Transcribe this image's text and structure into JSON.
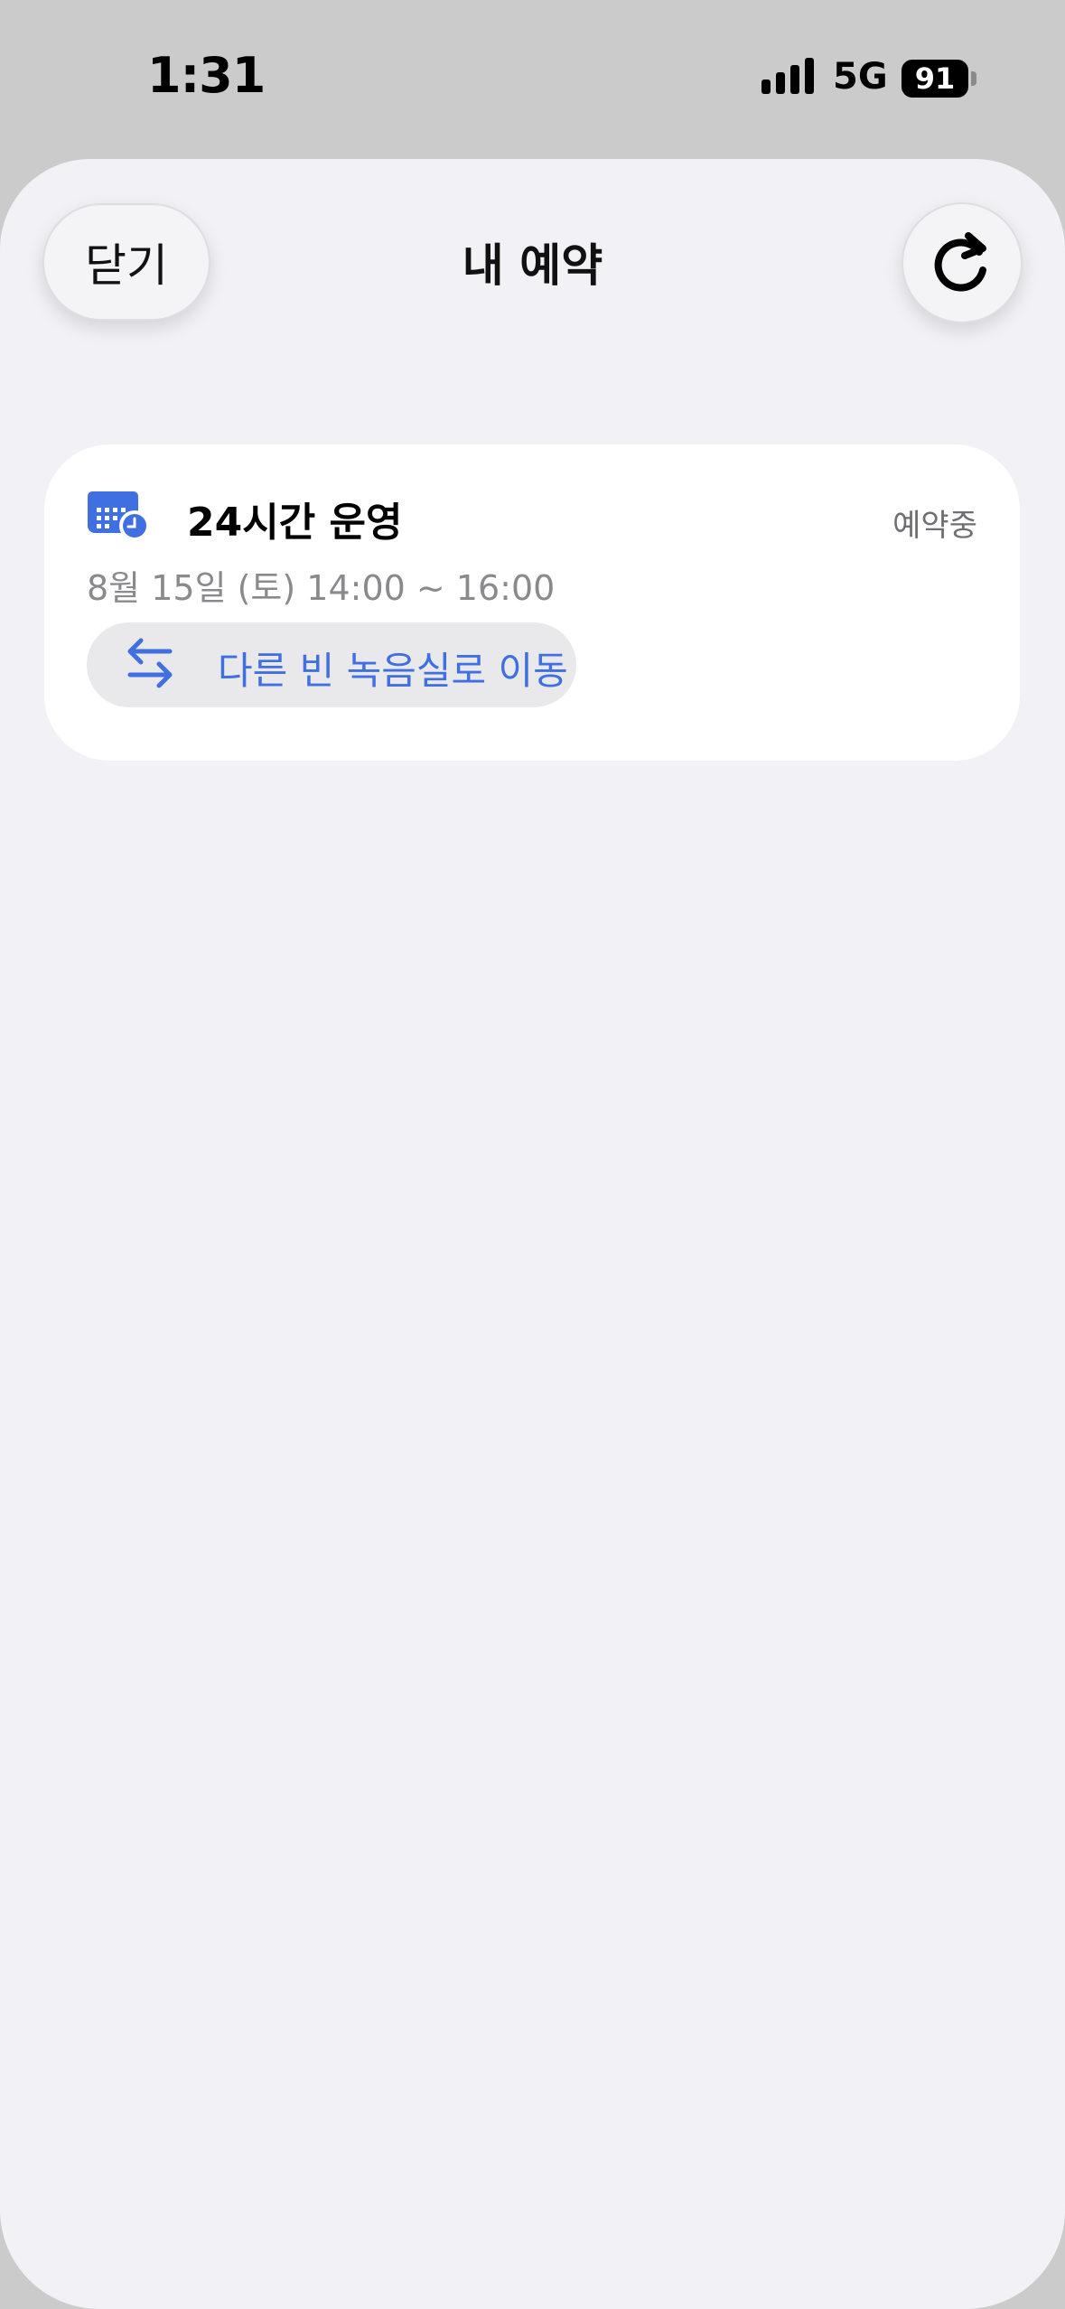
{
  "status_bar": {
    "time": "1:31",
    "network": "5G",
    "battery": "91"
  },
  "header": {
    "close_label": "닫기",
    "title": "내 예약",
    "refresh_icon": "refresh-icon"
  },
  "bookings": [
    {
      "title": "24시간 운영",
      "status": "예약중",
      "datetime": "8월 15일 (토) 14:00 ~ 16:00",
      "action_label": "다른 빈 녹음실로 이동",
      "icon": "calendar-clock-icon",
      "action_icon": "swap-arrows-icon"
    }
  ],
  "colors": {
    "accent": "#3f6fe0",
    "sheet_background": "#f1f1f6",
    "card_background": "#ffffff"
  }
}
